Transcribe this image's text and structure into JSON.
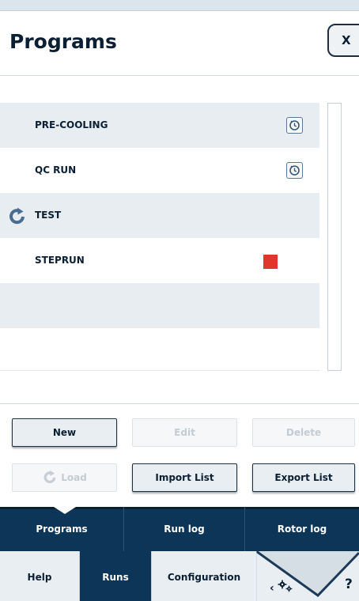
{
  "header": {
    "title": "Programs",
    "close_label": "X"
  },
  "programs": [
    {
      "name": "PRE-COOLING",
      "shaded": true,
      "icon": "clock-icon"
    },
    {
      "name": "QC RUN",
      "shaded": false,
      "icon": "clock-icon"
    },
    {
      "name": "TEST",
      "shaded": true,
      "icon": "loaded-arrow-icon"
    },
    {
      "name": "STEPRUN",
      "shaded": false,
      "icon": "stop-square-icon"
    },
    {
      "name": "",
      "shaded": true
    },
    {
      "name": "",
      "shaded": false
    }
  ],
  "actions": {
    "new": "New",
    "edit": "Edit",
    "delete": "Delete",
    "load": "Load",
    "import_list": "Import List",
    "export_list": "Export List"
  },
  "tabs": {
    "programs": "Programs",
    "run_log": "Run log",
    "rotor_log": "Rotor log",
    "active": "Programs"
  },
  "bottom_nav": {
    "help": "Help",
    "runs": "Runs",
    "configuration": "Configuration",
    "question": "?",
    "active": "Runs"
  },
  "colors": {
    "navy": "#0d3558",
    "stop_red": "#e1362b",
    "row_shade": "#e8edf2"
  }
}
